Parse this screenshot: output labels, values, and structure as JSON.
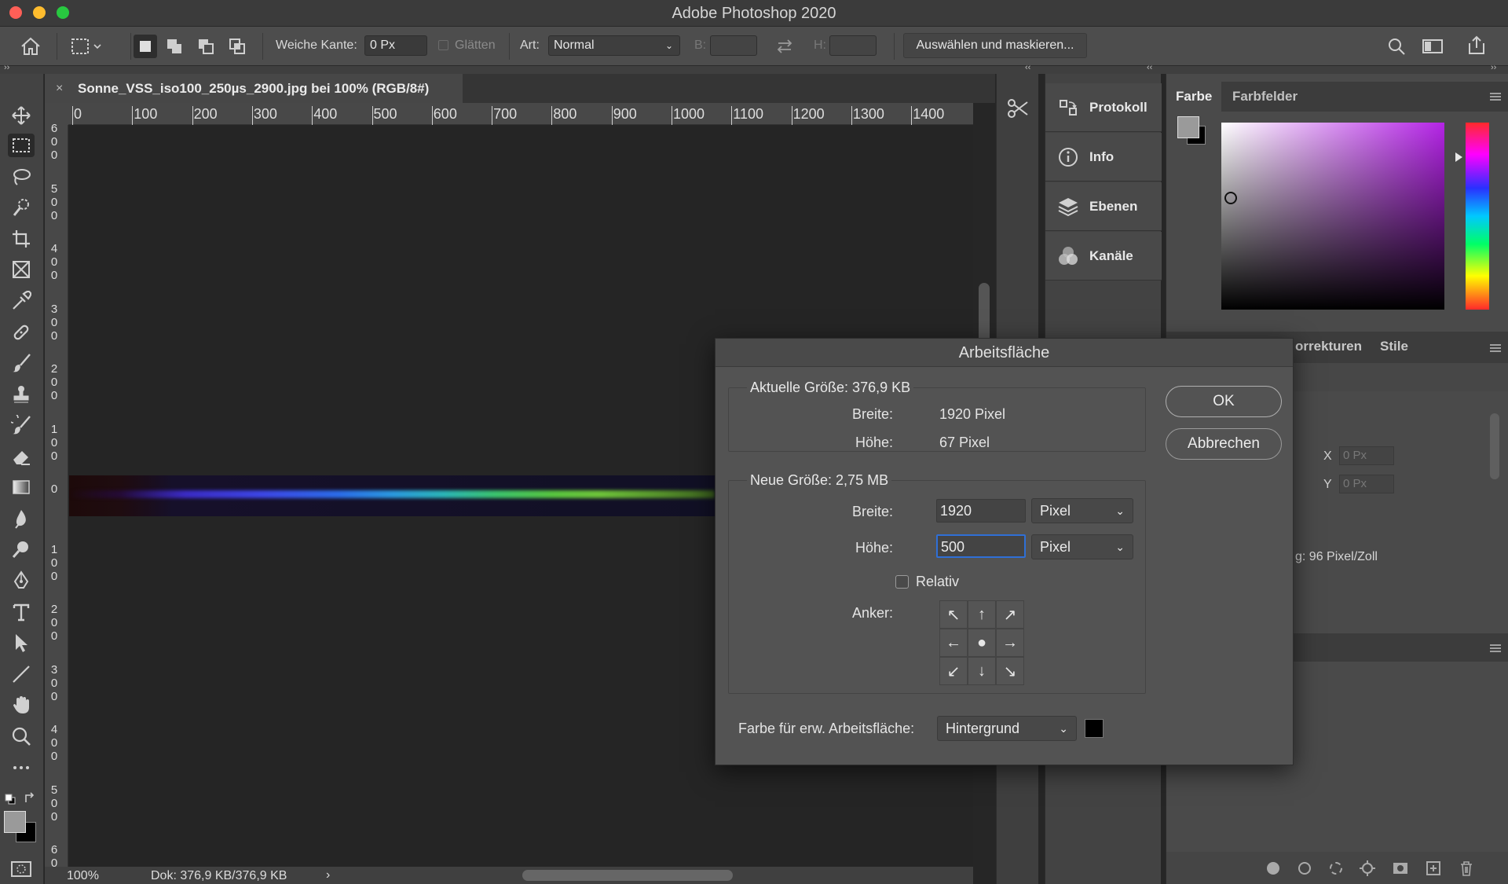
{
  "app": {
    "title": "Adobe Photoshop 2020"
  },
  "options_bar": {
    "feather_label": "Weiche Kante:",
    "feather_value": "0 Px",
    "antialias_label": "Glätten",
    "style_label": "Art:",
    "style_value": "Normal",
    "width_label": "B:",
    "height_label": "H:",
    "select_mask_button": "Auswählen und maskieren..."
  },
  "document": {
    "tab_title": "Sonne_VSS_iso100_250µs_2900.jpg bei 100% (RGB/8#)",
    "close_glyph": "×",
    "ruler_h": [
      "0",
      "100",
      "200",
      "300",
      "400",
      "500",
      "600",
      "700",
      "800",
      "900",
      "1000",
      "1100",
      "1200",
      "1300",
      "1400"
    ],
    "ruler_v": [
      "6\n0\n0",
      "5\n0\n0",
      "4\n0\n0",
      "3\n0\n0",
      "2\n0\n0",
      "1\n0\n0",
      "0",
      "1\n0\n0",
      "2\n0\n0",
      "3\n0\n0",
      "4\n0\n0",
      "5\n0\n0",
      "6\n0"
    ]
  },
  "status": {
    "zoom": "100%",
    "doc_info": "Dok: 376,9 KB/376,9 KB",
    "arrow": "›"
  },
  "panels": {
    "history": "Protokoll",
    "info": "Info",
    "layers": "Ebenen",
    "channels": "Kanäle",
    "color_tab": "Farbe",
    "swatches_tab": "Farbfelder",
    "adjustments_tab_partial": "orrekturen",
    "styles_tab": "Stile",
    "x_label": "X",
    "y_label": "Y",
    "x_value": "0 Px",
    "y_value": "0 Px",
    "resolution_partial": "g: 96 Pixel/Zoll"
  },
  "dialog": {
    "title": "Arbeitsfläche",
    "current_size": "Aktuelle Größe: 376,9 KB",
    "current_width_label": "Breite:",
    "current_width_value": "1920 Pixel",
    "current_height_label": "Höhe:",
    "current_height_value": "67 Pixel",
    "new_size": "Neue Größe: 2,75 MB",
    "new_width_label": "Breite:",
    "new_width_value": "1920",
    "new_width_unit": "Pixel",
    "new_height_label": "Höhe:",
    "new_height_value": "500",
    "new_height_unit": "Pixel",
    "relative_label": "Relativ",
    "anchor_label": "Anker:",
    "extension_color_label": "Farbe für erw. Arbeitsfläche:",
    "extension_color_value": "Hintergrund",
    "extension_swatch_color": "#000000",
    "ok_button": "OK",
    "cancel_button": "Abbrechen"
  },
  "colors": {
    "accent": "#2f6fd6",
    "foreground_swatch": "#9a9a9a",
    "background_swatch": "#000000"
  }
}
